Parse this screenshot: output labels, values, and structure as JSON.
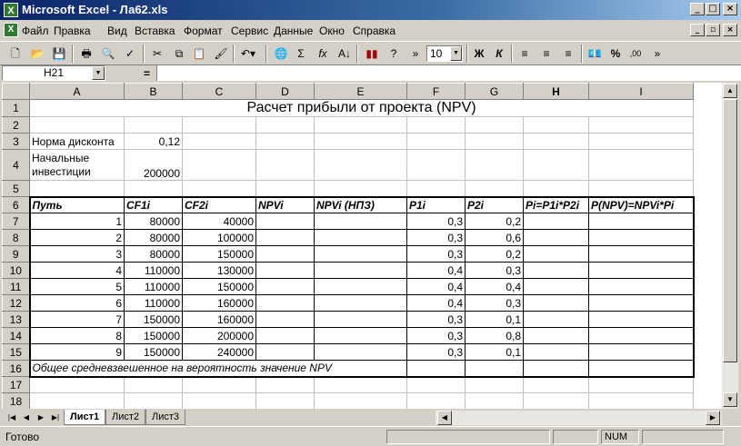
{
  "window": {
    "title": "Microsoft Excel - Ла62.xls",
    "app_icon": "X",
    "controls": [
      "_",
      "□",
      "×"
    ]
  },
  "menu": {
    "items": [
      "Файл",
      "Правка",
      "Вид",
      "Вставка",
      "Формат",
      "Сервис",
      "Данные",
      "Окно",
      "Справка"
    ],
    "doc_controls": [
      "_",
      "▫",
      "×"
    ]
  },
  "toolbar": {
    "font_size": "10",
    "buttons": [
      "new-icon",
      "open-icon",
      "save-icon",
      "print-icon",
      "preview-icon",
      "spelling-icon",
      "cut-icon",
      "copy-icon",
      "paste-icon",
      "format-painter-icon",
      "undo-icon",
      "web-icon",
      "autosum-icon",
      "function-icon",
      "sort-icon",
      "chart-icon",
      "help-icon",
      "bold-icon",
      "italic-icon",
      "align-left-icon",
      "align-center-icon",
      "align-right-icon",
      "currency-icon",
      "percent-icon",
      "decimal-icon"
    ],
    "bold_label": "Ж",
    "italic_label": "К",
    "autosum_label": "Σ",
    "function_label": "fx",
    "percent_label": "%"
  },
  "formula_bar": {
    "name_box": "H21",
    "equals": "=",
    "formula": ""
  },
  "sheet": {
    "columns": [
      "A",
      "B",
      "C",
      "D",
      "E",
      "F",
      "G",
      "H",
      "I"
    ],
    "title": "Расчет прибыли от проекта (NPV)",
    "rows": {
      "r1": "1",
      "r2": "2",
      "r3": "3",
      "r4": "4",
      "r5": "5",
      "r6": "6",
      "r16": "16",
      "r17": "17",
      "r18": "18"
    },
    "discount_label": "Норма дисконта",
    "discount_value": "0,12",
    "investment_label_1": "Начальные",
    "investment_label_2": "инвестиции",
    "investment_value": "200000",
    "headers": [
      "Путь",
      "CF1i",
      "CF2i",
      "NPVi",
      "NPVi (НПЗ)",
      "P1i",
      "P2i",
      "Pi=P1i*P2i",
      "P(NPV)=NPVi*Pi"
    ],
    "data_rows": [
      {
        "row": "7",
        "path": "1",
        "cf1": "80000",
        "cf2": "40000",
        "p1": "0,3",
        "p2": "0,2"
      },
      {
        "row": "8",
        "path": "2",
        "cf1": "80000",
        "cf2": "100000",
        "p1": "0,3",
        "p2": "0,6"
      },
      {
        "row": "9",
        "path": "3",
        "cf1": "80000",
        "cf2": "150000",
        "p1": "0,3",
        "p2": "0,2"
      },
      {
        "row": "10",
        "path": "4",
        "cf1": "110000",
        "cf2": "130000",
        "p1": "0,4",
        "p2": "0,3"
      },
      {
        "row": "11",
        "path": "5",
        "cf1": "110000",
        "cf2": "150000",
        "p1": "0,4",
        "p2": "0,4"
      },
      {
        "row": "12",
        "path": "6",
        "cf1": "110000",
        "cf2": "160000",
        "p1": "0,4",
        "p2": "0,3"
      },
      {
        "row": "13",
        "path": "7",
        "cf1": "150000",
        "cf2": "160000",
        "p1": "0,3",
        "p2": "0,1"
      },
      {
        "row": "14",
        "path": "8",
        "cf1": "150000",
        "cf2": "200000",
        "p1": "0,3",
        "p2": "0,8"
      },
      {
        "row": "15",
        "path": "9",
        "cf1": "150000",
        "cf2": "240000",
        "p1": "0,3",
        "p2": "0,1"
      }
    ],
    "footer_text": "Общее средневзвешенное на вероятность значение NPV"
  },
  "tabs": {
    "nav": [
      "|◀",
      "◀",
      "▶",
      "▶|"
    ],
    "sheets": [
      "Лист1",
      "Лист2",
      "Лист3"
    ],
    "active": "Лист1"
  },
  "status": {
    "text": "Готово",
    "num": "NUM"
  }
}
